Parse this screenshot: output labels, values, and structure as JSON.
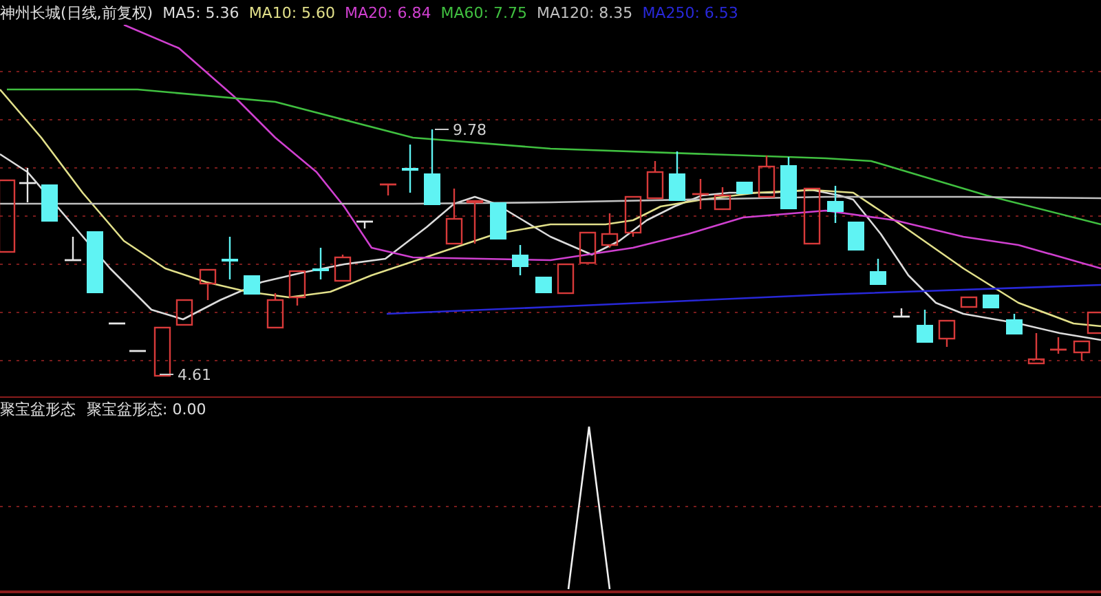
{
  "legend": {
    "title": "神州长城(日线,前复权)",
    "indicators": [
      {
        "label": "MA5: 5.36",
        "color": "#dcdcdc"
      },
      {
        "label": "MA10: 5.60",
        "color": "#e2e08a"
      },
      {
        "label": "MA20: 6.84",
        "color": "#d040d0"
      },
      {
        "label": "MA60: 7.75",
        "color": "#40c040"
      },
      {
        "label": "MA120: 8.35",
        "color": "#c0c0c0"
      },
      {
        "label": "MA250: 6.53",
        "color": "#2828d8"
      }
    ]
  },
  "price_chart": {
    "annotations": [
      {
        "kind": "high",
        "text": "9.78"
      },
      {
        "kind": "low",
        "text": "4.61"
      }
    ]
  },
  "indicator_panel": {
    "title": "聚宝盆形态",
    "reading": "聚宝盆形态: 0.00"
  }
}
